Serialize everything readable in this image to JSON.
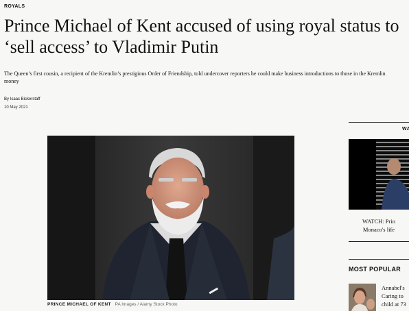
{
  "article": {
    "section": "ROYALS",
    "headline_line1": "Prince Michael of Kent accused of using royal status to",
    "headline_line2": "‘sell access’ to Vladimir Putin",
    "standfirst_line1": "The Queen’s first cousin, a recipient of the Kremlin’s prestigious Order of Friendship, told undercover reporters he could make business introductions to those in the Kremlin",
    "standfirst_line2": "money",
    "byline": "By Isaac Bickerstaff",
    "date": "10 May 2021"
  },
  "hero": {
    "caption_name": "PRINCE MICHAEL OF KENT",
    "caption_credit": "PA Images / Alamy Stock Photo"
  },
  "sidebar": {
    "watch_label": "WA",
    "watch_caption_line1": "WATCH: Prin",
    "watch_caption_line2": "Monaco's life",
    "popular_title": "MOST POPULAR",
    "popular_items": [
      {
        "line1": "Annabel's",
        "line2": "Caring to",
        "line3": "child at 73"
      }
    ]
  }
}
